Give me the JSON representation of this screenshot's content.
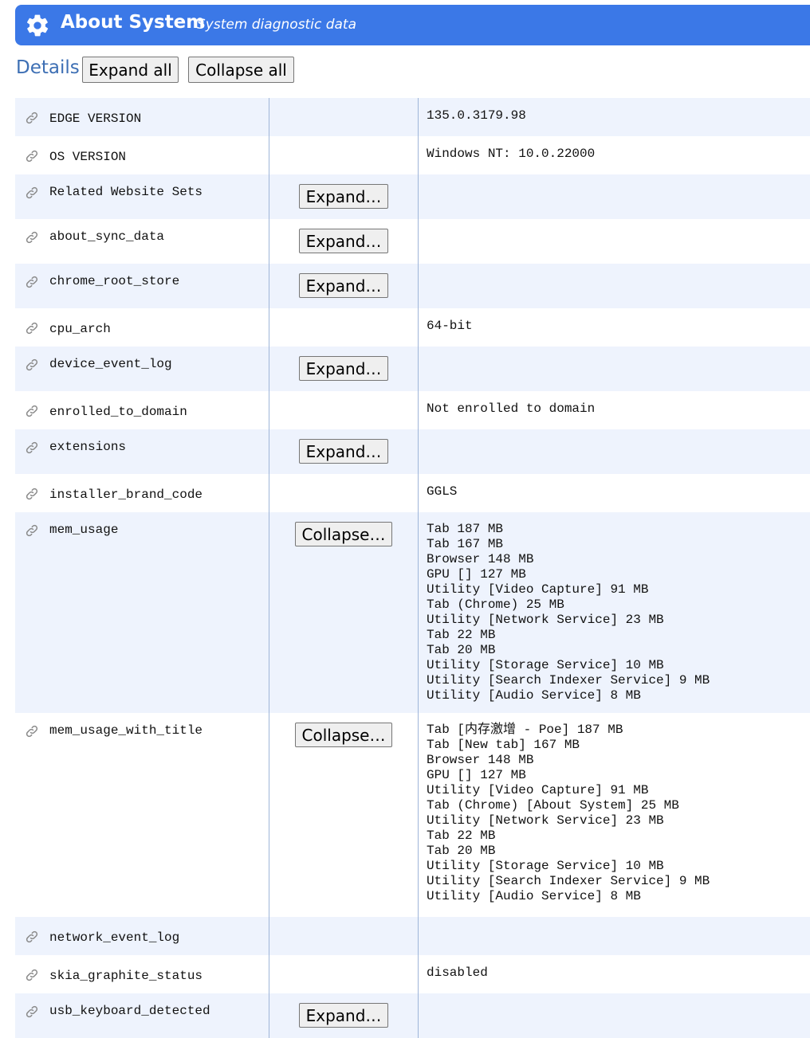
{
  "header": {
    "title": "About System",
    "subtitle": "System diagnostic data",
    "icon": "gear-icon",
    "color": "#3b78e7"
  },
  "toolbar": {
    "details_label": "Details",
    "expand_all": "Expand all",
    "collapse_all": "Collapse all"
  },
  "rows": [
    {
      "name": "EDGE VERSION",
      "button": "",
      "value": "135.0.3179.98"
    },
    {
      "name": "OS VERSION",
      "button": "",
      "value": "Windows NT: 10.0.22000"
    },
    {
      "name": "Related Website Sets",
      "button": "Expand…",
      "value": ""
    },
    {
      "name": "about_sync_data",
      "button": "Expand…",
      "value": ""
    },
    {
      "name": "chrome_root_store",
      "button": "Expand…",
      "value": ""
    },
    {
      "name": "cpu_arch",
      "button": "",
      "value": "64-bit"
    },
    {
      "name": "device_event_log",
      "button": "Expand…",
      "value": ""
    },
    {
      "name": "enrolled_to_domain",
      "button": "",
      "value": "Not enrolled to domain"
    },
    {
      "name": "extensions",
      "button": "Expand…",
      "value": ""
    },
    {
      "name": "installer_brand_code",
      "button": "",
      "value": "GGLS"
    },
    {
      "name": "mem_usage",
      "button": "Collapse…",
      "value": "Tab 187 MB\nTab 167 MB\nBrowser 148 MB\nGPU [] 127 MB\nUtility [Video Capture] 91 MB\nTab (Chrome) 25 MB\nUtility [Network Service] 23 MB\nTab 22 MB\nTab 20 MB\nUtility [Storage Service] 10 MB\nUtility [Search Indexer Service] 9 MB\nUtility [Audio Service] 8 MB"
    },
    {
      "name": "mem_usage_with_title",
      "button": "Collapse…",
      "value": "Tab [内存激增 - Poe] 187 MB\nTab [New tab] 167 MB\nBrowser 148 MB\nGPU [] 127 MB\nUtility [Video Capture] 91 MB\nTab (Chrome) [About System] 25 MB\nUtility [Network Service] 23 MB\nTab 22 MB\nTab 20 MB\nUtility [Storage Service] 10 MB\nUtility [Search Indexer Service] 9 MB\nUtility [Audio Service] 8 MB"
    },
    {
      "name": "network_event_log",
      "button": "",
      "value": ""
    },
    {
      "name": "skia_graphite_status",
      "button": "",
      "value": "disabled"
    },
    {
      "name": "usb_keyboard_detected",
      "button": "Expand…",
      "value": ""
    }
  ]
}
